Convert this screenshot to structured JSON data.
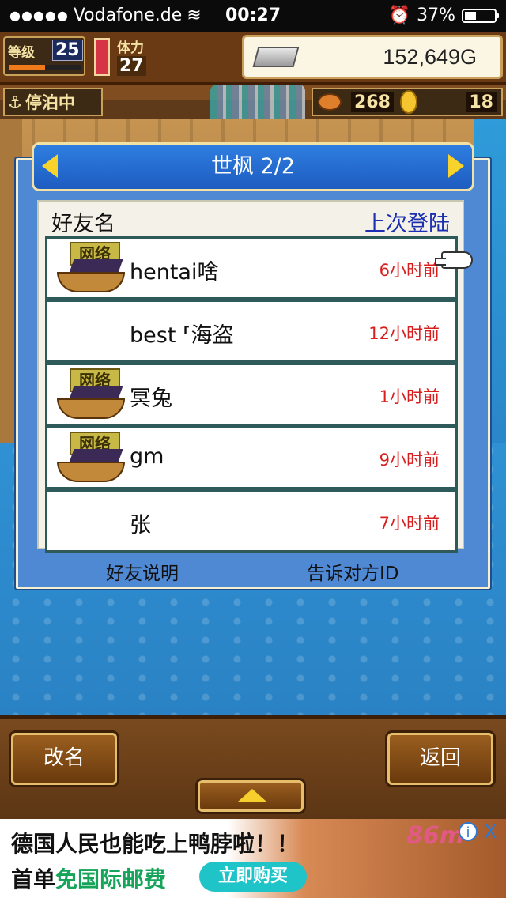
{
  "status_bar": {
    "carrier": "Vodafone.de",
    "time": "00:27",
    "battery": "37%"
  },
  "hud": {
    "level_label": "等级",
    "level": "25",
    "stamina_label": "体力",
    "stamina": "27",
    "gold": "152,649G",
    "state": "停泊中",
    "food": "268",
    "medals": "18"
  },
  "dialog": {
    "title": "世枫 2/2",
    "col_name": "好友名",
    "col_last_login": "上次登陆",
    "friends": [
      {
        "name": "hentai啥",
        "last_login": "6小时前",
        "online_tag": "网络"
      },
      {
        "name": "best ⸢海盗",
        "last_login": "12小时前",
        "online_tag": ""
      },
      {
        "name": "冥兔",
        "last_login": "1小时前",
        "online_tag": "网络"
      },
      {
        "name": "gm",
        "last_login": "9小时前",
        "online_tag": "网络"
      },
      {
        "name": "张",
        "last_login": "7小时前",
        "online_tag": ""
      }
    ],
    "friend_info": "好友说明",
    "tell_id": "告诉对方ID"
  },
  "bottom": {
    "rename": "改名",
    "back": "返回"
  },
  "ad": {
    "line1": "德国人民也能吃上鸭脖啦！！",
    "line2_prefix": "首单",
    "line2_highlight": "免国际邮费",
    "button": "立即购买",
    "brand": "86m",
    "info": "i",
    "close": "X"
  },
  "colors": {
    "accent_blue": "#1e5cc0",
    "time_red": "#d81f1f",
    "gold_frame": "#caa15a"
  }
}
